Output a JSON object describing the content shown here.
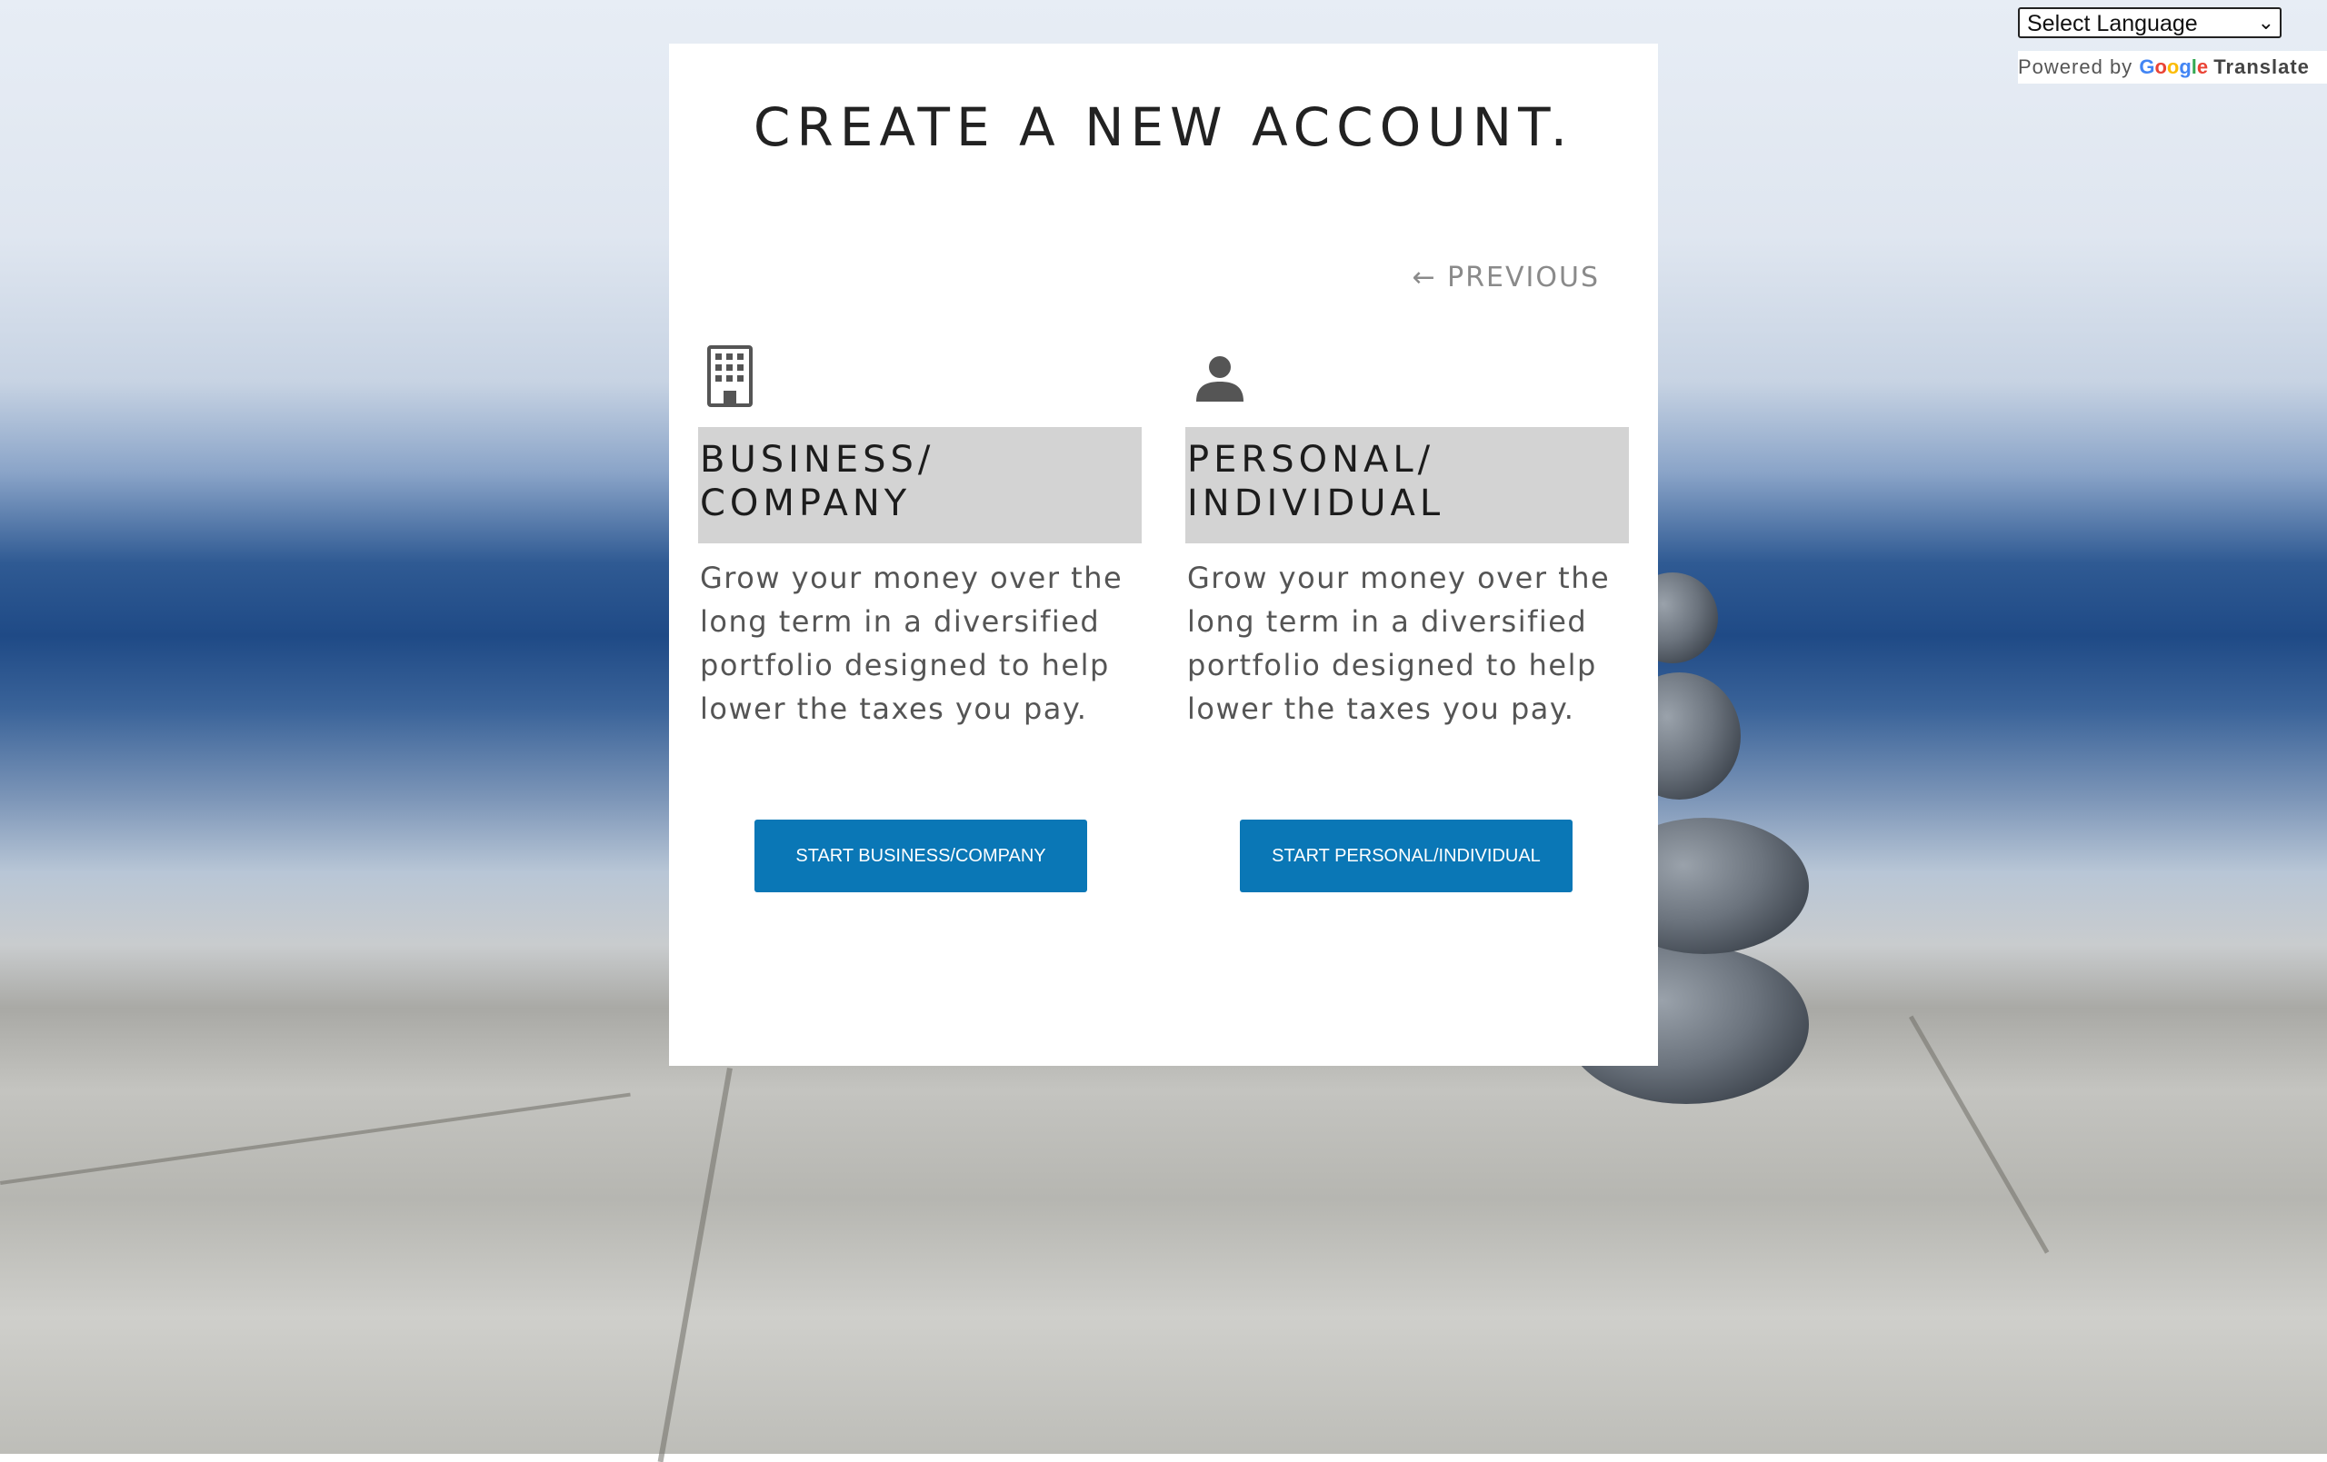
{
  "translate": {
    "select_label": "Select Language",
    "powered_prefix": "Powered by",
    "google": "Google",
    "translate": "Translate"
  },
  "card": {
    "title": "CREATE A NEW ACCOUNT.",
    "previous": "PREVIOUS",
    "previous_arrow": "←"
  },
  "business": {
    "icon": "building-icon",
    "heading_line1": "BUSINESS/",
    "heading_line2": "COMPANY",
    "description": "Grow your money over the long term in a diversified portfolio designed to help lower the taxes you pay.",
    "button": "START BUSINESS/COMPANY"
  },
  "personal": {
    "icon": "person-icon",
    "heading_line1": "PERSONAL/",
    "heading_line2": "INDIVIDUAL",
    "description": "Grow your money over the long term in a diversified portfolio designed to help lower the taxes you pay.",
    "button": "START PERSONAL/INDIVIDUAL"
  },
  "colors": {
    "button_bg": "#0a77b6",
    "heading_bg": "#d3d3d3"
  }
}
